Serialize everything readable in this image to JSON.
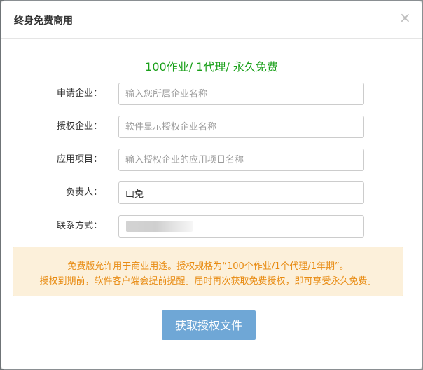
{
  "dialog": {
    "title": "终身免费商用",
    "close_glyph": "×",
    "close_icon": "close-icon"
  },
  "headline": "100作业/ 1代理/ 永久免费",
  "form": {
    "fields": [
      {
        "label": "申请企业：",
        "value": "",
        "placeholder": "输入您所属企业名称"
      },
      {
        "label": "授权企业：",
        "value": "",
        "placeholder": "软件显示授权企业名称"
      },
      {
        "label": "应用项目：",
        "value": "",
        "placeholder": "输入授权企业的应用项目名称"
      },
      {
        "label": "负责人：",
        "value": "山兔",
        "placeholder": ""
      },
      {
        "label": "联系方式：",
        "value": "",
        "placeholder": ""
      }
    ]
  },
  "notice": {
    "line1": "免费版允许用于商业用途。授权规格为“100个作业/1个代理/1年期”。",
    "line2": "授权到期前，软件客户端会提前提醒。届时再次获取免费授权，即可享受永久免费。"
  },
  "submit_label": "获取授权文件",
  "colors": {
    "headline": "#1aa01a",
    "notice_text": "#e88b12",
    "notice_bg": "#fcf0da",
    "button_bg": "#6fa7d6"
  }
}
